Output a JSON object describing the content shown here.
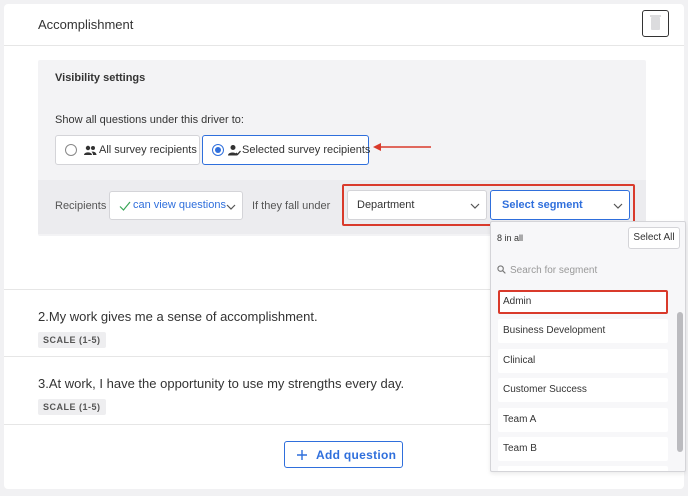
{
  "header": {
    "title": "Accomplishment",
    "delete_icon": "trash-icon"
  },
  "visibility": {
    "title": "Visibility settings",
    "question": "Show all questions under this driver to:",
    "options": [
      {
        "label": "All survey recipients",
        "icon": "group-icon",
        "selected": false
      },
      {
        "label": "Selected survey recipients",
        "icon": "person-check-icon",
        "selected": true
      }
    ],
    "recipients_label": "Recipients",
    "permission": {
      "value": "can view questions",
      "icon": "check-icon"
    },
    "fall_under_label": "If they fall under",
    "department_select": "Department",
    "segment_select": "Select segment",
    "annotation_color": "#d93a2b",
    "accent_color": "#2f6fdc"
  },
  "questions": [
    {
      "text": "2.My work gives me a sense of accomplishment.",
      "badge": "SCALE (1-5)"
    },
    {
      "text": "3.At work, I have the opportunity to use my strengths every day.",
      "badge": "SCALE (1-5)"
    }
  ],
  "add_question": {
    "label": "Add question",
    "icon": "plus-icon"
  },
  "segment_dropdown": {
    "count": "8 in all",
    "select_all": "Select All",
    "search_placeholder": "Search for segment",
    "items": [
      "Admin",
      "Business Development",
      "Clinical",
      "Customer Success",
      "Team A",
      "Team B"
    ],
    "highlighted_item": "Admin"
  }
}
